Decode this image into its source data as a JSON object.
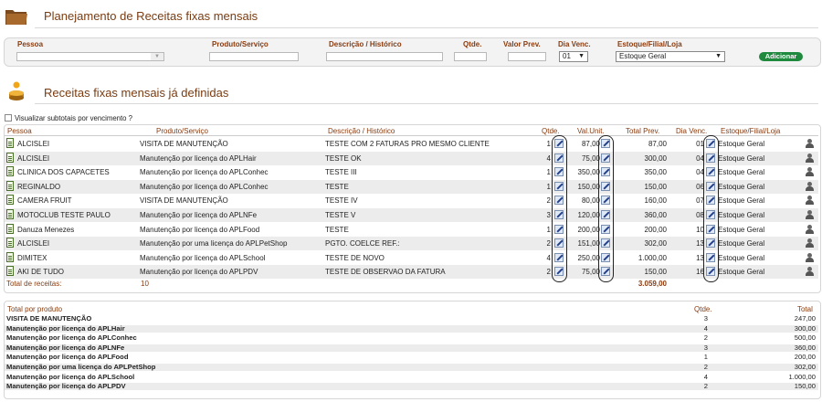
{
  "page_title": "Planejamento de Receitas fixas mensais",
  "entry_form": {
    "labels": {
      "pessoa": "Pessoa",
      "produto": "Produto/Serviço",
      "descricao": "Descrição / Histórico",
      "qtde": "Qtde.",
      "valor_prev": "Valor Prev.",
      "dia_venc": "Dia Venc.",
      "estoque": "Estoque/Filial/Loja"
    },
    "pessoa_value": "",
    "produto_value": "",
    "descricao_value": "",
    "qtde_value": "",
    "valor_value": "",
    "dia_venc_selected": "01",
    "estoque_selected": "Estoque Geral",
    "add_button": "Adicionar"
  },
  "section_title": "Receitas fixas mensais já definidas",
  "subtotal_checkbox": {
    "label": "Visualizar subtotais por vencimento ?",
    "checked": false
  },
  "table": {
    "headers": {
      "pessoa": "Pessoa",
      "produto": "Produto/Serviço",
      "descricao": "Descrição / Histórico",
      "qtde": "Qtde.",
      "val_unit": "Val.Unit.",
      "total_prev": "Total Prev.",
      "dia_venc": "Dia Venc.",
      "estoque": "Estoque/Filial/Loja"
    },
    "rows": [
      {
        "pessoa": "ALCISLEI",
        "produto": "VISITA DE MANUTENÇÃO",
        "descricao": "TESTE COM 2 FATURAS PRO MESMO CLIENTE",
        "qtde": "1",
        "val_unit": "87,00",
        "total": "87,00",
        "dia": "01",
        "estoque": "Estoque Geral"
      },
      {
        "pessoa": "ALCISLEI",
        "produto": "Manutenção por licença do APLHair",
        "descricao": "TESTE OK",
        "qtde": "4",
        "val_unit": "75,00",
        "total": "300,00",
        "dia": "04",
        "estoque": "Estoque Geral"
      },
      {
        "pessoa": "CLINICA DOS CAPACETES",
        "produto": "Manutenção por licença do APLConhec",
        "descricao": "TESTE III",
        "qtde": "1",
        "val_unit": "350,00",
        "total": "350,00",
        "dia": "04",
        "estoque": "Estoque Geral"
      },
      {
        "pessoa": "REGINALDO",
        "produto": "Manutenção por licença do APLConhec",
        "descricao": "TESTE",
        "qtde": "1",
        "val_unit": "150,00",
        "total": "150,00",
        "dia": "06",
        "estoque": "Estoque Geral"
      },
      {
        "pessoa": "CAMERA FRUIT",
        "produto": "VISITA DE MANUTENÇÃO",
        "descricao": "TESTE IV",
        "qtde": "2",
        "val_unit": "80,00",
        "total": "160,00",
        "dia": "07",
        "estoque": "Estoque Geral"
      },
      {
        "pessoa": "MOTOCLUB TESTE PAULO",
        "produto": "Manutenção por licença do APLNFe",
        "descricao": "TESTE V",
        "qtde": "3",
        "val_unit": "120,00",
        "total": "360,00",
        "dia": "08",
        "estoque": "Estoque Geral"
      },
      {
        "pessoa": "Danuza Menezes",
        "produto": "Manutenção por licença do APLFood",
        "descricao": "TESTE",
        "qtde": "1",
        "val_unit": "200,00",
        "total": "200,00",
        "dia": "10",
        "estoque": "Estoque Geral"
      },
      {
        "pessoa": "ALCISLEI",
        "produto": "Manutenção por uma licença do APLPetShop",
        "descricao": "PGTO. COELCE REF.:",
        "qtde": "2",
        "val_unit": "151,00",
        "total": "302,00",
        "dia": "13",
        "estoque": "Estoque Geral"
      },
      {
        "pessoa": "DIMITEX",
        "produto": "Manutenção por licença do APLSchool",
        "descricao": "TESTE DE NOVO",
        "qtde": "4",
        "val_unit": "250,00",
        "total": "1.000,00",
        "dia": "13",
        "estoque": "Estoque Geral"
      },
      {
        "pessoa": "AKI DE TUDO",
        "produto": "Manutenção por licença do APLPDV",
        "descricao": "TESTE DE OBSERVAO DA FATURA",
        "qtde": "2",
        "val_unit": "75,00",
        "total": "150,00",
        "dia": "16",
        "estoque": "Estoque Geral"
      }
    ],
    "footer": {
      "label": "Total de receitas:",
      "count": "10",
      "total": "3.059,00"
    }
  },
  "summary": {
    "headers": {
      "produto": "Total por produto",
      "qtde": "Qtde.",
      "total": "Total"
    },
    "rows": [
      {
        "produto": "VISITA DE MANUTENÇÃO",
        "qtde": "3",
        "total": "247,00"
      },
      {
        "produto": "Manutenção por licença do APLHair",
        "qtde": "4",
        "total": "300,00"
      },
      {
        "produto": "Manutenção por licença do APLConhec",
        "qtde": "2",
        "total": "500,00"
      },
      {
        "produto": "Manutenção por licença do APLNFe",
        "qtde": "3",
        "total": "360,00"
      },
      {
        "produto": "Manutenção por licença do APLFood",
        "qtde": "1",
        "total": "200,00"
      },
      {
        "produto": "Manutenção por uma licença do APLPetShop",
        "qtde": "2",
        "total": "302,00"
      },
      {
        "produto": "Manutenção por licença do APLSchool",
        "qtde": "4",
        "total": "1.000,00"
      },
      {
        "produto": "Manutenção por licença do APLPDV",
        "qtde": "2",
        "total": "150,00"
      }
    ]
  },
  "colors": {
    "title": "#7a3c12",
    "header_text": "#8a3b0f",
    "add_button": "#1f8a3e",
    "row_alt": "#ececec"
  }
}
